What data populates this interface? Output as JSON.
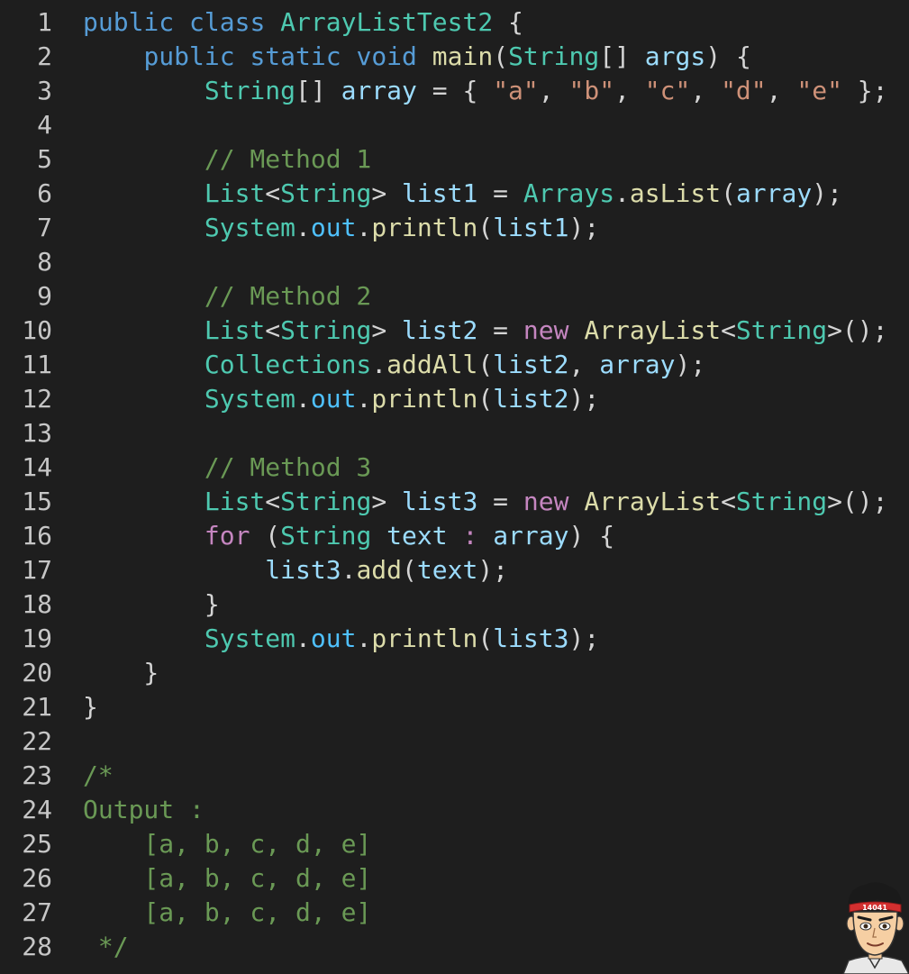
{
  "editor": {
    "colors": {
      "background": "#1e1e1e",
      "keyword": "#569cd6",
      "type": "#4ec9b0",
      "function": "#dcdcaa",
      "variable": "#9cdcfe",
      "field": "#4fc1ff",
      "string": "#ce9178",
      "comment": "#6a9955",
      "control": "#c586c0"
    },
    "lines": [
      {
        "n": "1",
        "tokens": [
          [
            "kw",
            "public"
          ],
          [
            "pl",
            " "
          ],
          [
            "kw",
            "class"
          ],
          [
            "pl",
            " "
          ],
          [
            "ty",
            "ArrayListTest2"
          ],
          [
            "pl",
            " {"
          ]
        ]
      },
      {
        "n": "2",
        "tokens": [
          [
            "pl",
            "    "
          ],
          [
            "kw",
            "public"
          ],
          [
            "pl",
            " "
          ],
          [
            "kw",
            "static"
          ],
          [
            "pl",
            " "
          ],
          [
            "kw",
            "void"
          ],
          [
            "pl",
            " "
          ],
          [
            "fn",
            "main"
          ],
          [
            "pl",
            "("
          ],
          [
            "ty",
            "String"
          ],
          [
            "pl",
            "[] "
          ],
          [
            "var",
            "args"
          ],
          [
            "pl",
            ") {"
          ]
        ]
      },
      {
        "n": "3",
        "tokens": [
          [
            "pl",
            "        "
          ],
          [
            "ty",
            "String"
          ],
          [
            "pl",
            "[] "
          ],
          [
            "var",
            "array"
          ],
          [
            "pl",
            " = { "
          ],
          [
            "str",
            "\"a\""
          ],
          [
            "pl",
            ", "
          ],
          [
            "str",
            "\"b\""
          ],
          [
            "pl",
            ", "
          ],
          [
            "str",
            "\"c\""
          ],
          [
            "pl",
            ", "
          ],
          [
            "str",
            "\"d\""
          ],
          [
            "pl",
            ", "
          ],
          [
            "str",
            "\"e\""
          ],
          [
            "pl",
            " };"
          ]
        ]
      },
      {
        "n": "4",
        "tokens": []
      },
      {
        "n": "5",
        "tokens": [
          [
            "pl",
            "        "
          ],
          [
            "cm",
            "// Method 1"
          ]
        ]
      },
      {
        "n": "6",
        "tokens": [
          [
            "pl",
            "        "
          ],
          [
            "ty",
            "List"
          ],
          [
            "pl",
            "<"
          ],
          [
            "ty",
            "String"
          ],
          [
            "pl",
            "> "
          ],
          [
            "var",
            "list1"
          ],
          [
            "pl",
            " = "
          ],
          [
            "ty",
            "Arrays"
          ],
          [
            "pl",
            "."
          ],
          [
            "fn",
            "asList"
          ],
          [
            "pl",
            "("
          ],
          [
            "var",
            "array"
          ],
          [
            "pl",
            ");"
          ]
        ]
      },
      {
        "n": "7",
        "tokens": [
          [
            "pl",
            "        "
          ],
          [
            "ty",
            "System"
          ],
          [
            "pl",
            "."
          ],
          [
            "fld",
            "out"
          ],
          [
            "pl",
            "."
          ],
          [
            "fn",
            "println"
          ],
          [
            "pl",
            "("
          ],
          [
            "var",
            "list1"
          ],
          [
            "pl",
            ");"
          ]
        ]
      },
      {
        "n": "8",
        "tokens": []
      },
      {
        "n": "9",
        "tokens": [
          [
            "pl",
            "        "
          ],
          [
            "cm",
            "// Method 2"
          ]
        ]
      },
      {
        "n": "10",
        "tokens": [
          [
            "pl",
            "        "
          ],
          [
            "ty",
            "List"
          ],
          [
            "pl",
            "<"
          ],
          [
            "ty",
            "String"
          ],
          [
            "pl",
            "> "
          ],
          [
            "var",
            "list2"
          ],
          [
            "pl",
            " = "
          ],
          [
            "ctl",
            "new"
          ],
          [
            "pl",
            " "
          ],
          [
            "fn",
            "ArrayList"
          ],
          [
            "pl",
            "<"
          ],
          [
            "ty",
            "String"
          ],
          [
            "pl",
            ">();"
          ]
        ]
      },
      {
        "n": "11",
        "tokens": [
          [
            "pl",
            "        "
          ],
          [
            "ty",
            "Collections"
          ],
          [
            "pl",
            "."
          ],
          [
            "fn",
            "addAll"
          ],
          [
            "pl",
            "("
          ],
          [
            "var",
            "list2"
          ],
          [
            "pl",
            ", "
          ],
          [
            "var",
            "array"
          ],
          [
            "pl",
            ");"
          ]
        ]
      },
      {
        "n": "12",
        "tokens": [
          [
            "pl",
            "        "
          ],
          [
            "ty",
            "System"
          ],
          [
            "pl",
            "."
          ],
          [
            "fld",
            "out"
          ],
          [
            "pl",
            "."
          ],
          [
            "fn",
            "println"
          ],
          [
            "pl",
            "("
          ],
          [
            "var",
            "list2"
          ],
          [
            "pl",
            ");"
          ]
        ]
      },
      {
        "n": "13",
        "tokens": []
      },
      {
        "n": "14",
        "tokens": [
          [
            "pl",
            "        "
          ],
          [
            "cm",
            "// Method 3"
          ]
        ]
      },
      {
        "n": "15",
        "tokens": [
          [
            "pl",
            "        "
          ],
          [
            "ty",
            "List"
          ],
          [
            "pl",
            "<"
          ],
          [
            "ty",
            "String"
          ],
          [
            "pl",
            "> "
          ],
          [
            "var",
            "list3"
          ],
          [
            "pl",
            " = "
          ],
          [
            "ctl",
            "new"
          ],
          [
            "pl",
            " "
          ],
          [
            "fn",
            "ArrayList"
          ],
          [
            "pl",
            "<"
          ],
          [
            "ty",
            "String"
          ],
          [
            "pl",
            ">();"
          ]
        ]
      },
      {
        "n": "16",
        "tokens": [
          [
            "pl",
            "        "
          ],
          [
            "ctl",
            "for"
          ],
          [
            "pl",
            " ("
          ],
          [
            "ty",
            "String"
          ],
          [
            "pl",
            " "
          ],
          [
            "var",
            "text"
          ],
          [
            "pl",
            " "
          ],
          [
            "ctl",
            ":"
          ],
          [
            "pl",
            " "
          ],
          [
            "var",
            "array"
          ],
          [
            "pl",
            ") {"
          ]
        ]
      },
      {
        "n": "17",
        "tokens": [
          [
            "pl",
            "            "
          ],
          [
            "var",
            "list3"
          ],
          [
            "pl",
            "."
          ],
          [
            "fn",
            "add"
          ],
          [
            "pl",
            "("
          ],
          [
            "var",
            "text"
          ],
          [
            "pl",
            ");"
          ]
        ]
      },
      {
        "n": "18",
        "tokens": [
          [
            "pl",
            "        }"
          ]
        ]
      },
      {
        "n": "19",
        "tokens": [
          [
            "pl",
            "        "
          ],
          [
            "ty",
            "System"
          ],
          [
            "pl",
            "."
          ],
          [
            "fld",
            "out"
          ],
          [
            "pl",
            "."
          ],
          [
            "fn",
            "println"
          ],
          [
            "pl",
            "("
          ],
          [
            "var",
            "list3"
          ],
          [
            "pl",
            ");"
          ]
        ]
      },
      {
        "n": "20",
        "tokens": [
          [
            "pl",
            "    }"
          ]
        ]
      },
      {
        "n": "21",
        "tokens": [
          [
            "pl",
            "}"
          ]
        ]
      },
      {
        "n": "22",
        "tokens": []
      },
      {
        "n": "23",
        "tokens": [
          [
            "cm",
            "/*"
          ]
        ]
      },
      {
        "n": "24",
        "tokens": [
          [
            "cm",
            "Output :"
          ]
        ]
      },
      {
        "n": "25",
        "tokens": [
          [
            "cm",
            "    [a, b, c, d, e]"
          ]
        ]
      },
      {
        "n": "26",
        "tokens": [
          [
            "cm",
            "    [a, b, c, d, e]"
          ]
        ]
      },
      {
        "n": "27",
        "tokens": [
          [
            "cm",
            "    [a, b, c, d, e]"
          ]
        ]
      },
      {
        "n": "28",
        "tokens": [
          [
            "cm",
            " */"
          ]
        ]
      }
    ]
  },
  "avatar": {
    "icon": "cartoon-avatar-icon",
    "badge_text": "14041"
  }
}
